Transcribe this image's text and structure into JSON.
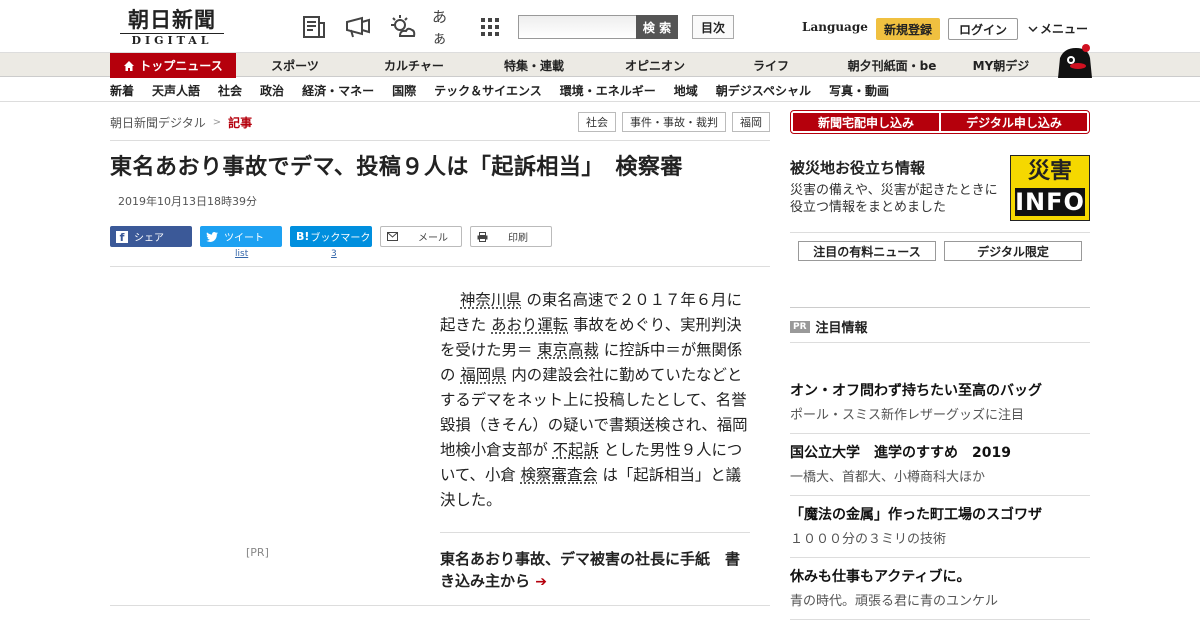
{
  "header": {
    "logo_main": "朝日新聞",
    "logo_sub": "DIGITAL",
    "search_placeholder": "",
    "search_button": "検 索",
    "toc_button": "目次",
    "language": "Language",
    "signup": "新規登録",
    "login": "ログイン",
    "menu": "メニュー",
    "font_size_icon_text": "あぁ"
  },
  "mainnav": {
    "items": [
      {
        "label": "トップニュース",
        "active": true
      },
      {
        "label": "スポーツ"
      },
      {
        "label": "カルチャー"
      },
      {
        "label": "特集・連載"
      },
      {
        "label": "オピニオン"
      },
      {
        "label": "ライフ"
      },
      {
        "label": "朝夕刊紙面・be"
      },
      {
        "label": "MY朝デジ"
      }
    ]
  },
  "subnav": {
    "items": [
      "新着",
      "天声人語",
      "社会",
      "政治",
      "経済・マネー",
      "国際",
      "テック＆サイエンス",
      "環境・エネルギー",
      "地域",
      "朝デジスペシャル",
      "写真・動画"
    ]
  },
  "article": {
    "breadcrumb": [
      "朝日新聞デジタル",
      "記事"
    ],
    "breadcrumb_sep": ">",
    "tags": [
      "社会",
      "事件・事故・裁判",
      "福岡"
    ],
    "headline": "東名あおり事故でデマ、投稿９人は「起訴相当」　検察審",
    "timestamp": "2019年10月13日18時39分",
    "share": {
      "facebook": "シェア",
      "twitter": "ツイート",
      "hatena": "ブックマーク",
      "mail": "メール",
      "print": "印刷",
      "twitter_count": "list",
      "hatena_count": "3"
    },
    "body": {
      "p1": "神奈川県",
      "p2": "の東名高速で２０１７年６月に起きた",
      "p3": "あおり運転",
      "p4": "事故をめぐり、実刑判決を受けた男＝",
      "p5": "東京高裁",
      "p6": "に控訴中＝が無関係の",
      "p7": "福岡県",
      "p8": "内の建設会社に勤めていたなどとするデマをネット上に投稿したとして、名誉毀損（きそん）の疑いで書類送検され、福岡地検小倉支部が",
      "p9": "不起訴",
      "p10": "とした男性９人について、小倉",
      "p11": "検察審査会",
      "p12": "は「起訴相当」と議決した。"
    },
    "pr_label": "[PR]",
    "related": "東名あおり事故、デマ被害の社長に手紙　書き込み主から"
  },
  "sidebar": {
    "red_buttons": [
      "新聞宅配申し込み",
      "デジタル申し込み"
    ],
    "disaster_title": "被災地お役立ち情報",
    "disaster_desc": "災害の備えや、災害が起きたときに役立つ情報をまとめました",
    "disaster_logo_top": "災害",
    "disaster_logo_bottom": "INFO",
    "tabs": [
      "注目の有料ニュース",
      "デジタル限定"
    ],
    "pr_badge": "PR",
    "pr_title": "注目情報",
    "ads": [
      {
        "title": "オン・オフ問わず持ちたい至高のバッグ",
        "sub": "ポール・スミス新作レザーグッズに注目"
      },
      {
        "title": "国公立大学　進学のすすめ　2019",
        "sub": "一橋大、首都大、小樽商科大ほか"
      },
      {
        "title": "「魔法の金属」作った町工場のスゴワザ",
        "sub": "１０００分の３ミリの技術"
      },
      {
        "title": "休みも仕事もアクティブに。",
        "sub": "青の時代。頑張る君に青のユンケル"
      }
    ]
  },
  "colors": {
    "brand_red": "#b5000c",
    "signup_yellow": "#f0c040",
    "facebook": "#3b5998",
    "twitter": "#1da1f2",
    "hatena": "#008fde"
  }
}
